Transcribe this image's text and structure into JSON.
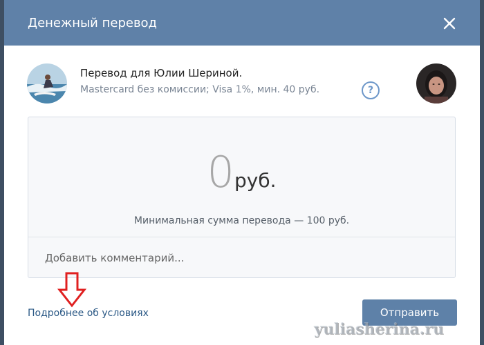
{
  "dialog": {
    "title": "Денежный перевод",
    "close_icon": "close-icon"
  },
  "recipient": {
    "name": "Перевод для Юлии Шериной.",
    "fees": "Mastercard без комиссии; Visa 1%, мин. 40 руб.",
    "help_label": "?"
  },
  "amount": {
    "value": "0",
    "currency": "руб.",
    "min_note": "Минимальная сумма перевода — 100 руб."
  },
  "comment": {
    "placeholder": "Добавить комментарий..."
  },
  "footer": {
    "terms_link": "Подробнее об условиях",
    "send_label": "Отправить"
  },
  "watermark": "yuliasherina.ru",
  "colors": {
    "header": "#5f81a8",
    "button": "#5e81a8",
    "link": "#2a5885",
    "annotation": "#e02020"
  }
}
